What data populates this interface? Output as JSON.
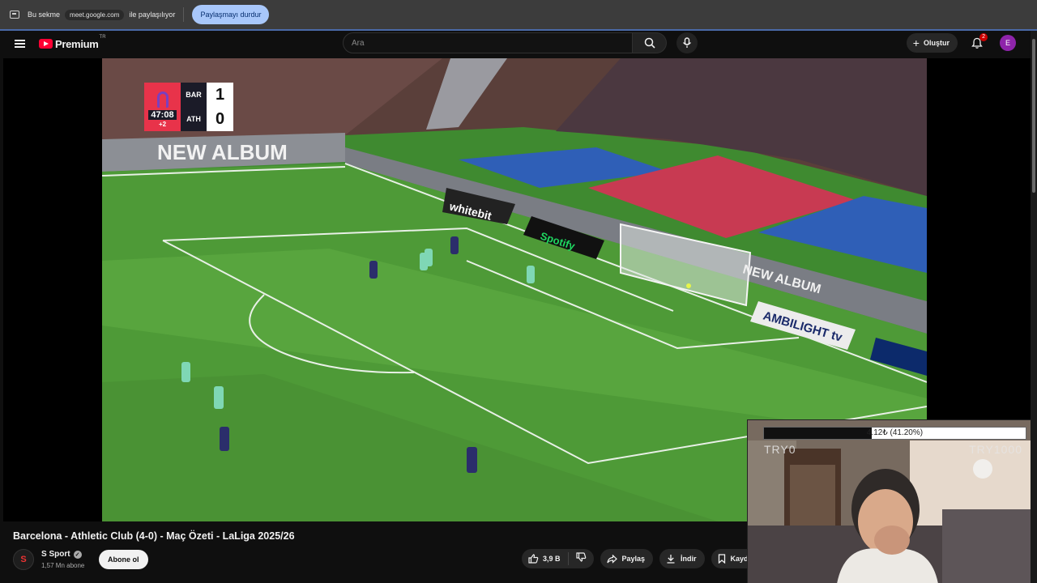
{
  "share_bar": {
    "prefix": "Bu sekme",
    "site": "meet.google.com",
    "suffix": "ile paylaşılıyor",
    "stop_button": "Paylaşmayı durdur"
  },
  "masthead": {
    "logo_word": "Premium",
    "country_code": "TR",
    "search_placeholder": "Ara",
    "create_label": "Oluştur",
    "notification_count": "2",
    "avatar_letter": "E"
  },
  "scorebug": {
    "time": "47:08",
    "added_time": "+2",
    "home_team": "BAR",
    "away_team": "ATH",
    "home_score": "1",
    "away_score": "0"
  },
  "video": {
    "title": "Barcelona - Athletic Club (4-0) - Maç Özeti - LaLiga 2025/26",
    "channel_name": "S Sport",
    "subscribers": "1,57 Mn abone",
    "subscribe_label": "Abone ol",
    "like_count": "3,9 B",
    "share_label": "Paylaş",
    "download_label": "İndir",
    "save_label": "Kayd"
  },
  "webcam_overlay": {
    "progress_text": "4.12₺ (41.20%)",
    "progress_fraction": 0.412,
    "left_label": "TRY0",
    "right_label": "TRY1000"
  },
  "colors": {
    "youtube_red": "#ff0033",
    "share_button": "#a8c7fa",
    "avatar": "#8e24aa",
    "badge": "#cc0000",
    "scorebug_red": "#e8334a"
  }
}
